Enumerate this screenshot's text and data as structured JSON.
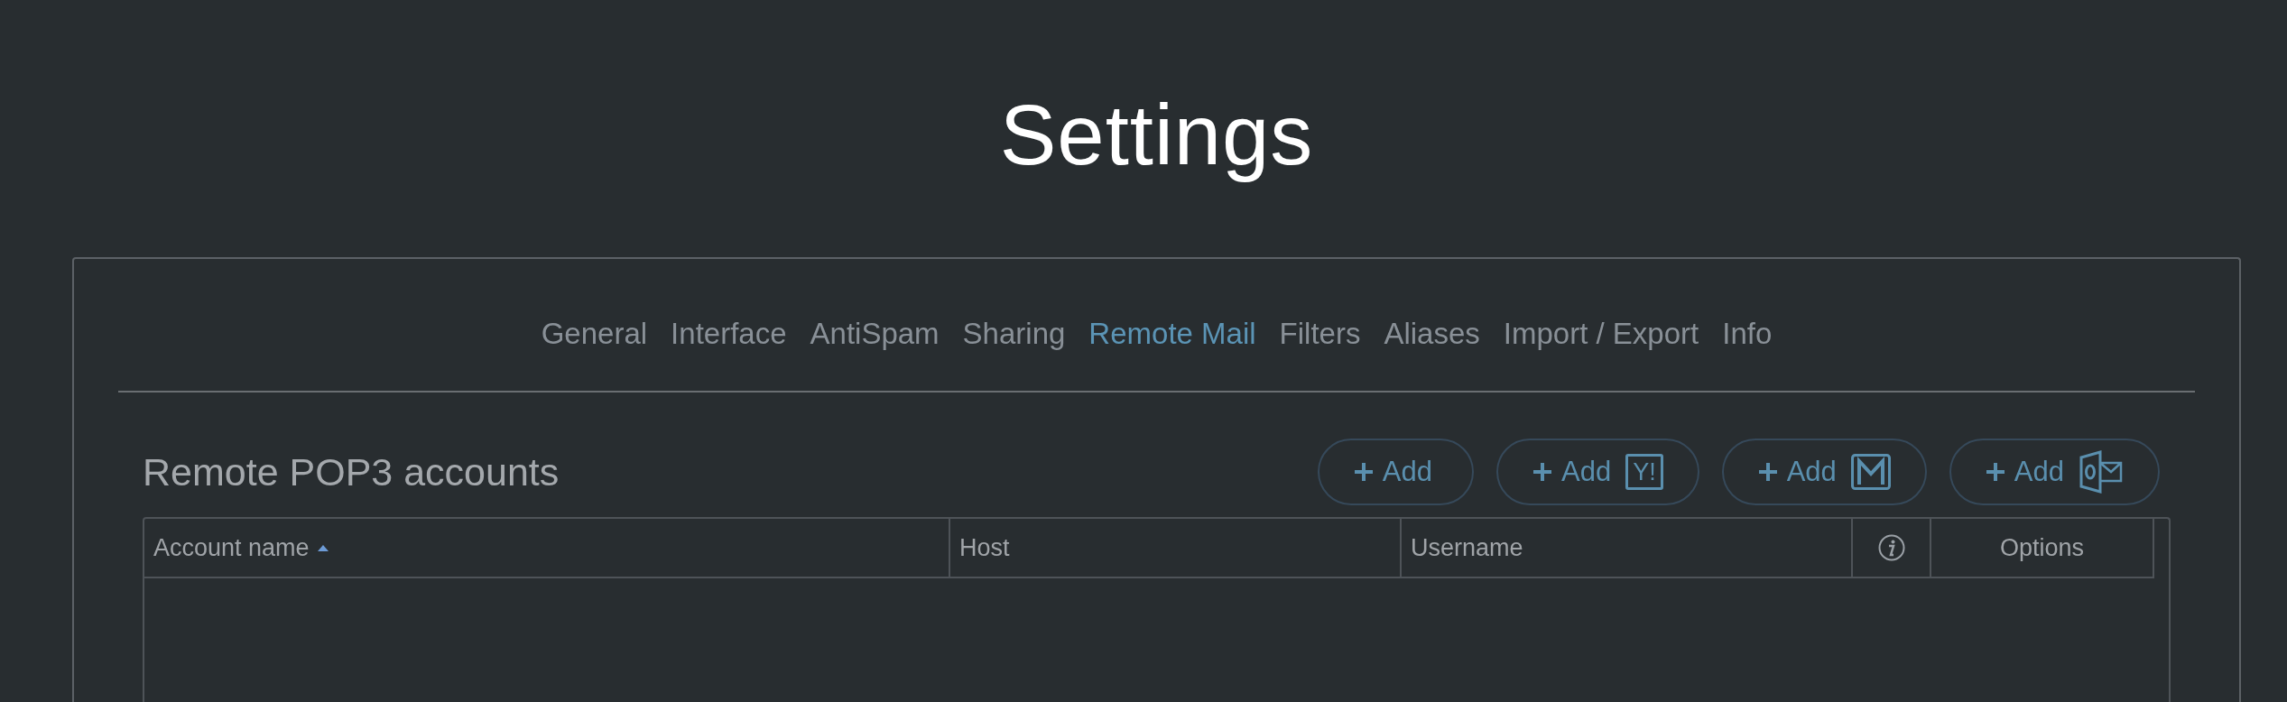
{
  "title": "Settings",
  "tabs": [
    {
      "label": "General",
      "selected": false
    },
    {
      "label": "Interface",
      "selected": false
    },
    {
      "label": "AntiSpam",
      "selected": false
    },
    {
      "label": "Sharing",
      "selected": false
    },
    {
      "label": "Remote Mail",
      "selected": true
    },
    {
      "label": "Filters",
      "selected": false
    },
    {
      "label": "Aliases",
      "selected": false
    },
    {
      "label": "Import / Export",
      "selected": false
    },
    {
      "label": "Info",
      "selected": false
    }
  ],
  "section": {
    "heading": "Remote POP3 accounts",
    "buttons": [
      {
        "label": "Add",
        "kind": "plain"
      },
      {
        "label": "Add",
        "kind": "yahoo",
        "badge": "Y!"
      },
      {
        "label": "Add",
        "kind": "gmail"
      },
      {
        "label": "Add",
        "kind": "outlook"
      }
    ],
    "table": {
      "columns": [
        {
          "kind": "text",
          "label": "Account name",
          "sorted": true
        },
        {
          "kind": "text",
          "label": "Host",
          "sorted": false
        },
        {
          "kind": "text",
          "label": "Username",
          "sorted": false
        },
        {
          "kind": "info",
          "sorted": false
        },
        {
          "kind": "center",
          "label": "Options",
          "sorted": false
        }
      ]
    }
  }
}
